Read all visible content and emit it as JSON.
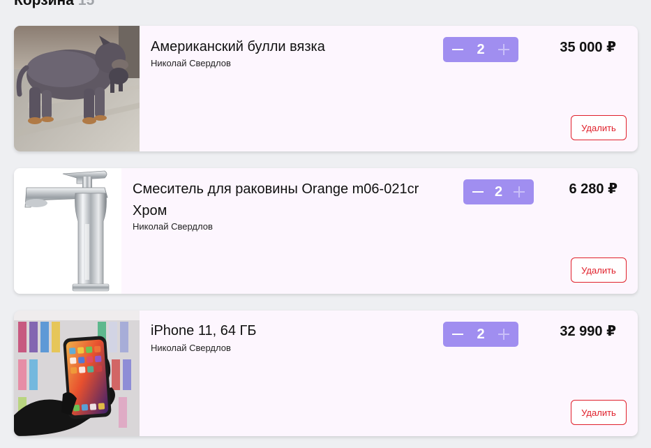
{
  "header": {
    "title": "Корзина",
    "count": "15"
  },
  "cart": {
    "items": [
      {
        "image_icon": "dog-photo",
        "title": "Американский булли вязка",
        "seller": "Николай Свердлов",
        "quantity": "2",
        "price": "35 000 ₽",
        "delete_label": "Удалить"
      },
      {
        "image_icon": "faucet-photo",
        "title": "Смеситель для раковины Orange m06-021cr Хром",
        "seller": "Николай Свердлов",
        "quantity": "2",
        "price": "6 280 ₽",
        "delete_label": "Удалить"
      },
      {
        "image_icon": "smartphone-photo",
        "title": "iPhone 11, 64 ГБ",
        "seller": "Николай Свердлов",
        "quantity": "2",
        "price": "32 990 ₽",
        "delete_label": "Удалить"
      }
    ]
  },
  "colors": {
    "accent": "#a08ef0",
    "danger": "#e0202b",
    "card_bg": "#fdf6fe",
    "page_bg": "#eeeff2"
  }
}
